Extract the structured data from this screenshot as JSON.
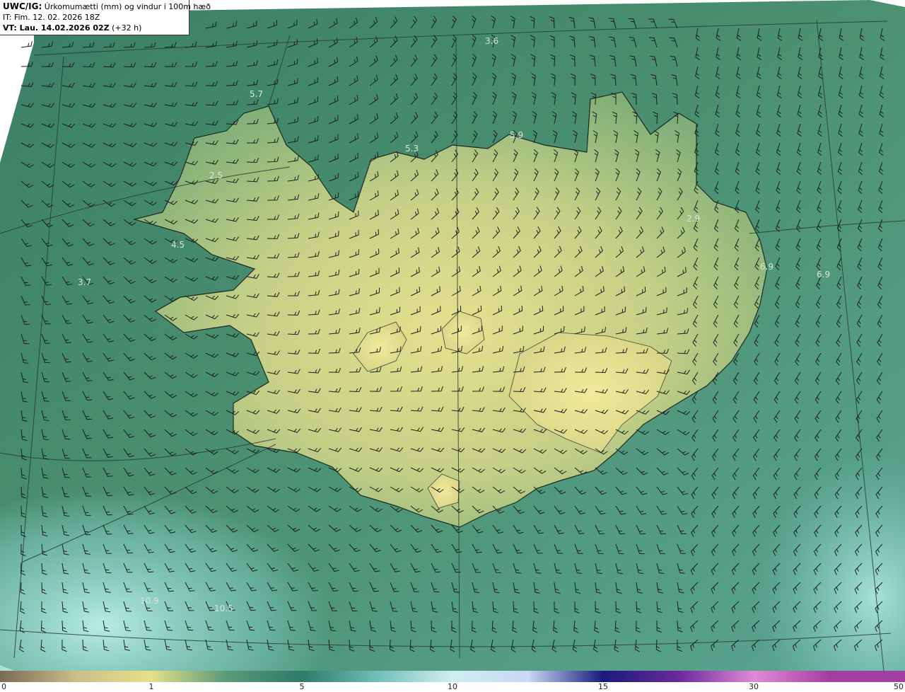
{
  "header": {
    "model": "UWC/IG:",
    "title": "Úrkomumætti (mm) og vindur i 100m hæð",
    "init_time": "IT: Fim. 12. 02. 2026 18Z",
    "valid_prefix": "VT: Lau. 14.02.2026 02Z",
    "valid_suffix": "(+32 h)"
  },
  "map_values": [
    {
      "text": "3.6"
    },
    {
      "text": "5.7"
    },
    {
      "text": "5.9"
    },
    {
      "text": "5.3"
    },
    {
      "text": "2.5"
    },
    {
      "text": "4.5"
    },
    {
      "text": "3.7"
    },
    {
      "text": "2.9"
    },
    {
      "text": "6.9"
    },
    {
      "text": "6.9"
    },
    {
      "text": "10.9"
    },
    {
      "text": "10.5"
    }
  ],
  "colorbar": {
    "ticks": [
      "0",
      "1",
      "5",
      "10",
      "15",
      "30",
      "50"
    ],
    "colors": [
      "#7a6a55",
      "#c8bf8a",
      "#e6e08a",
      "#5a9a78",
      "#2f7a6a",
      "#6fbfb8",
      "#cfeef0",
      "#c8d8f5",
      "#1a1a7a",
      "#6a2a9a",
      "#e08ad8",
      "#a040a0"
    ]
  },
  "colors": {
    "land_high": "#e2dd8c",
    "land_mid": "#a9c27e",
    "sea_main": "#3e876b",
    "sea_light": "#9fd8d2"
  }
}
